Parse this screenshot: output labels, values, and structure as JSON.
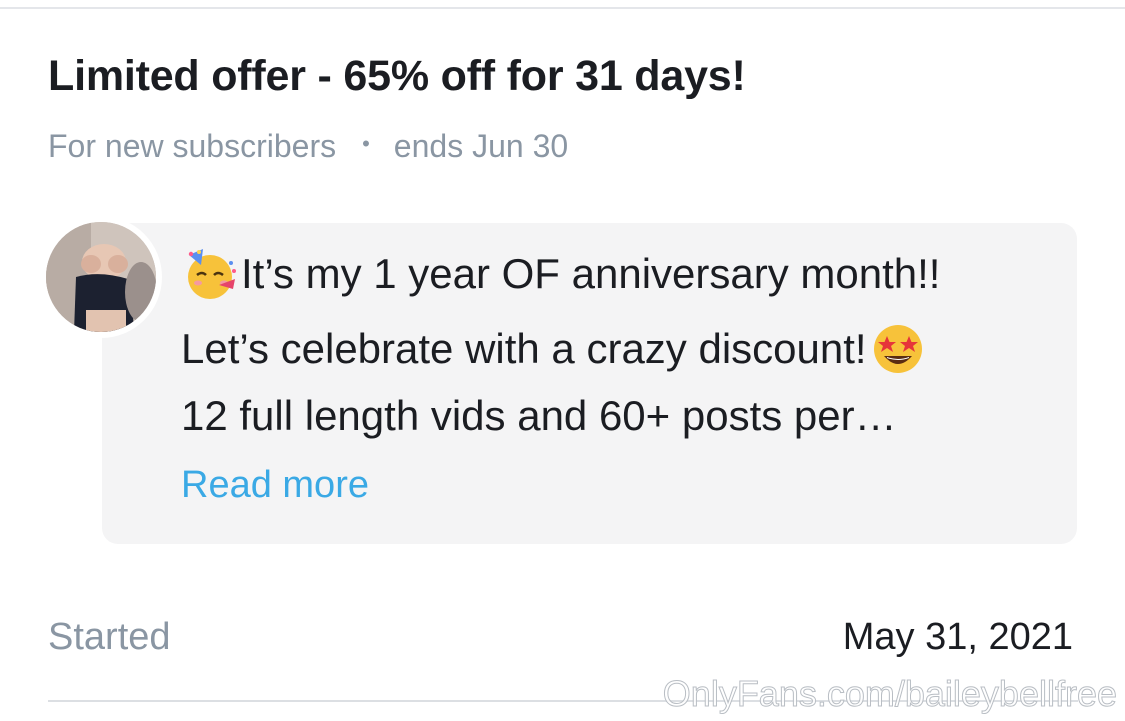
{
  "offer": {
    "title": "Limited offer - 65% off for 31 days!",
    "audience": "For new subscribers",
    "separator": "•",
    "ends": "ends Jun 30"
  },
  "message": {
    "line1": "It’s my 1 year OF anniversary month!!",
    "line2": "Let’s celebrate with a crazy discount!",
    "line3": "12 full length vids and 60+ posts per…",
    "read_more": "Read more",
    "emoji_1": "partying-face-emoji",
    "emoji_2": "star-struck-emoji"
  },
  "details": {
    "started_label": "Started",
    "started_value": "May 31, 2021"
  },
  "watermark": "OnlyFans.com/baileybellfree",
  "colors": {
    "title": "#1b1d22",
    "muted": "#8a96a3",
    "link": "#3aa9e5",
    "bubble_bg": "#f4f4f5"
  }
}
